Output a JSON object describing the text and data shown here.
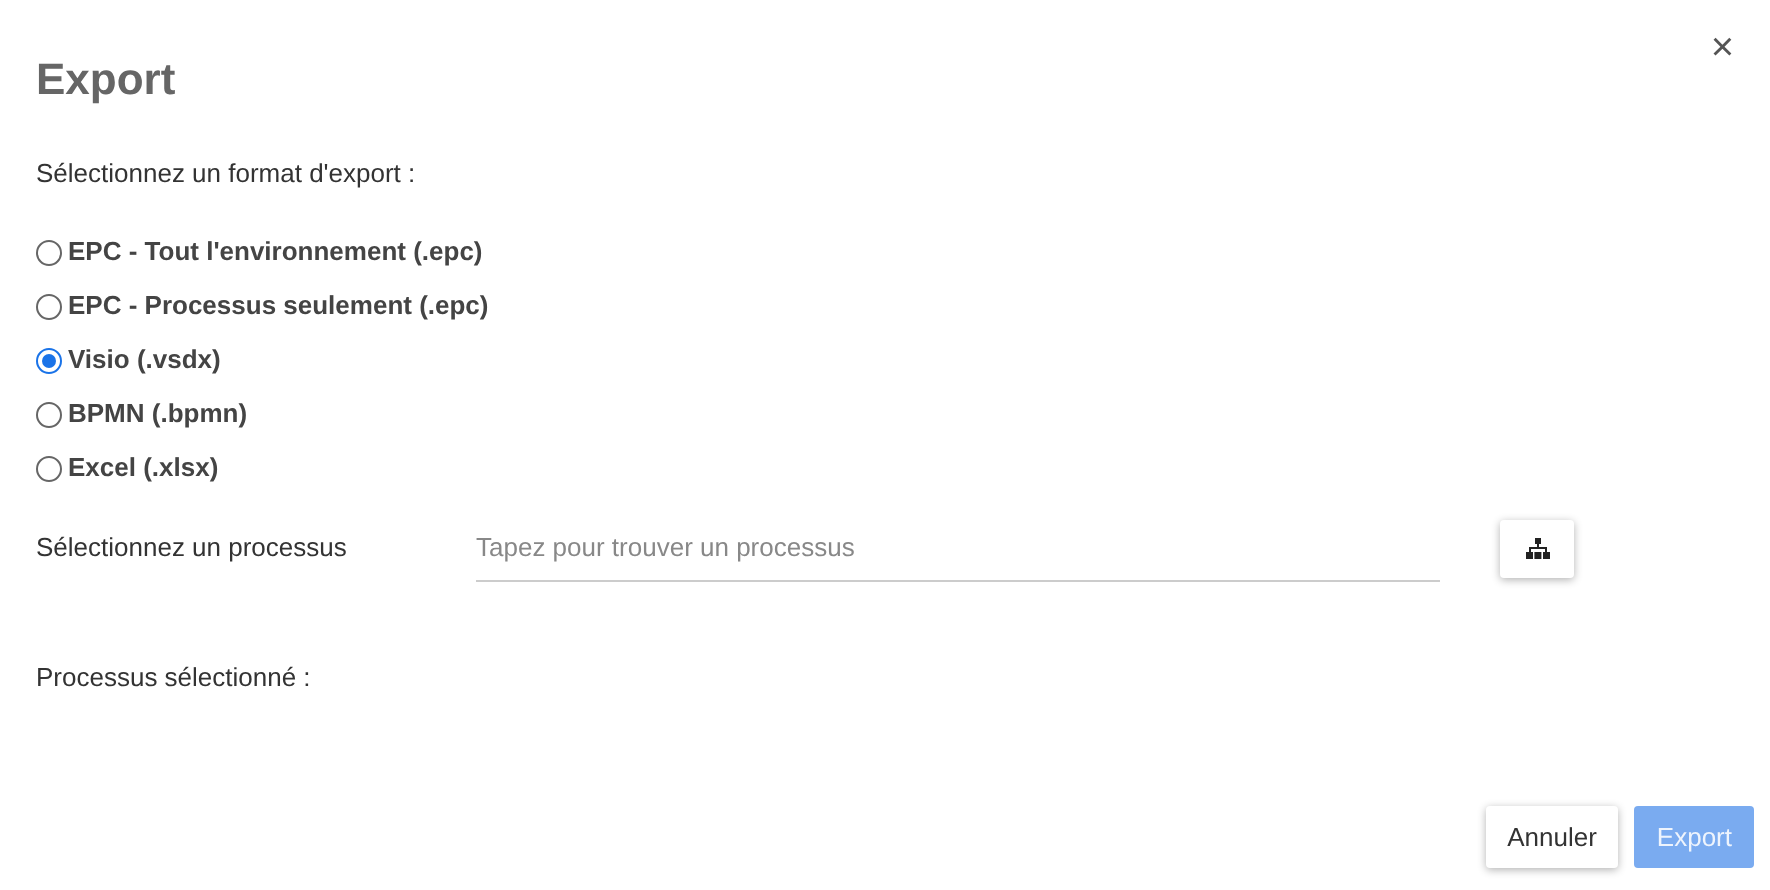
{
  "dialog": {
    "title": "Export",
    "close": "×"
  },
  "format_label": "Sélectionnez un format d'export :",
  "formats": [
    {
      "label": "EPC - Tout l'environnement (.epc)",
      "selected": false
    },
    {
      "label": "EPC - Processus seulement (.epc)",
      "selected": false
    },
    {
      "label": "Visio (.vsdx)",
      "selected": true
    },
    {
      "label": "BPMN (.bpmn)",
      "selected": false
    },
    {
      "label": "Excel (.xlsx)",
      "selected": false
    }
  ],
  "process": {
    "label": "Sélectionnez un processus",
    "placeholder": "Tapez pour trouver un processus"
  },
  "selected_label": "Processus sélectionné :",
  "buttons": [
    {
      "label": "Annuler",
      "kind": "secondary",
      "disabled": false
    },
    {
      "label": "Export",
      "kind": "primary",
      "disabled": true
    }
  ]
}
